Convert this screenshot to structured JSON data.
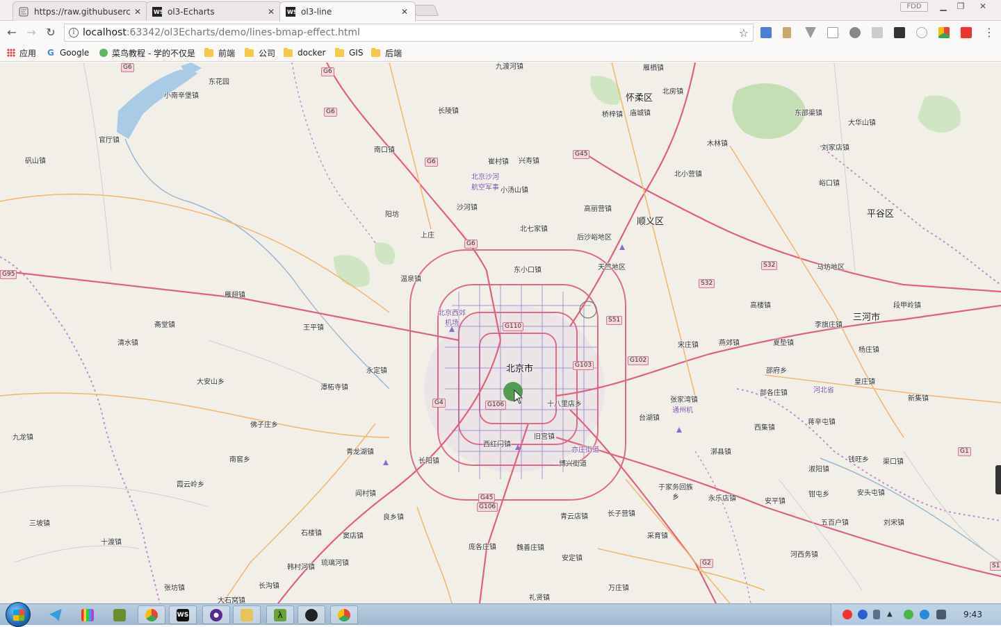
{
  "browser": {
    "tabs": [
      {
        "title": "https://raw.githubuserc",
        "active": false,
        "icon": "github-icon"
      },
      {
        "title": "ol3-Echarts",
        "active": false,
        "icon": "webstorm-icon"
      },
      {
        "title": "ol3-line",
        "active": true,
        "icon": "webstorm-icon"
      }
    ],
    "profile_label": "FDD",
    "url_host": "localhost",
    "url_path": ":63342/ol3Echarts/demo/lines-bmap-effect.html",
    "bookmarks": [
      {
        "label": "应用",
        "icon": "apps-grid-icon"
      },
      {
        "label": "Google",
        "icon": "google-icon"
      },
      {
        "label": "菜鸟教程 - 学的不仅是",
        "icon": "runoob-icon"
      },
      {
        "label": "前端",
        "icon": "folder-icon"
      },
      {
        "label": "公司",
        "icon": "folder-icon"
      },
      {
        "label": "docker",
        "icon": "folder-icon"
      },
      {
        "label": "GIS",
        "icon": "folder-icon"
      },
      {
        "label": "后端",
        "icon": "folder-icon"
      }
    ]
  },
  "map": {
    "places": [
      {
        "name": "小南辛堡镇"
      },
      {
        "name": "东花园"
      },
      {
        "name": "官厅镇"
      },
      {
        "name": "矾山镇"
      },
      {
        "name": "九渡河镇"
      },
      {
        "name": "怀柔区"
      },
      {
        "name": "北房镇"
      },
      {
        "name": "雁栖镇"
      },
      {
        "name": "长陵镇"
      },
      {
        "name": "桥梓镇"
      },
      {
        "name": "庙城镇"
      },
      {
        "name": "东邵渠镇"
      },
      {
        "name": "大华山镇"
      },
      {
        "name": "刘家店镇"
      },
      {
        "name": "南口镇"
      },
      {
        "name": "崔村镇"
      },
      {
        "name": "兴寿镇"
      },
      {
        "name": "木林镇"
      },
      {
        "name": "北京沙河"
      },
      {
        "name": "航空军事"
      },
      {
        "name": "小汤山镇"
      },
      {
        "name": "北小营镇"
      },
      {
        "name": "峪口镇"
      },
      {
        "name": "沙河镇"
      },
      {
        "name": "阳坊"
      },
      {
        "name": "高丽营镇"
      },
      {
        "name": "顺义区"
      },
      {
        "name": "平谷区"
      },
      {
        "name": "上庄"
      },
      {
        "name": "北七家镇"
      },
      {
        "name": "后沙峪地区"
      },
      {
        "name": "东小口镇"
      },
      {
        "name": "天竺地区"
      },
      {
        "name": "马坊地区"
      },
      {
        "name": "温泉镇"
      },
      {
        "name": "雁翅镇"
      },
      {
        "name": "高楼镇"
      },
      {
        "name": "段甲岭镇"
      },
      {
        "name": "北京西郊"
      },
      {
        "name": "机场"
      },
      {
        "name": "三河市"
      },
      {
        "name": "斋堂镇"
      },
      {
        "name": "王平镇"
      },
      {
        "name": "李旗庄镇"
      },
      {
        "name": "清水镇"
      },
      {
        "name": "宋庄镇"
      },
      {
        "name": "燕郊镇"
      },
      {
        "name": "夏垫镇"
      },
      {
        "name": "杨庄镇"
      },
      {
        "name": "永定镇"
      },
      {
        "name": "北京市"
      },
      {
        "name": "邵府乡"
      },
      {
        "name": "大安山乡"
      },
      {
        "name": "潭柘寺镇"
      },
      {
        "name": "部各庄镇"
      },
      {
        "name": "河北省"
      },
      {
        "name": "皇庄镇"
      },
      {
        "name": "十八里店乡"
      },
      {
        "name": "张家湾镇"
      },
      {
        "name": "通州机"
      },
      {
        "name": "新集镇"
      },
      {
        "name": "佛子庄乡"
      },
      {
        "name": "台湖镇"
      },
      {
        "name": "蒋辛屯镇"
      },
      {
        "name": "九龙镇"
      },
      {
        "name": "西集镇"
      },
      {
        "name": "西红门镇"
      },
      {
        "name": "旧宫镇"
      },
      {
        "name": "青龙湖镇"
      },
      {
        "name": "亦庄街道"
      },
      {
        "name": "漷县镇"
      },
      {
        "name": "南窖乡"
      },
      {
        "name": "长阳镇"
      },
      {
        "name": "博兴街道"
      },
      {
        "name": "钱旺乡"
      },
      {
        "name": "渠口镇"
      },
      {
        "name": "霞云岭乡"
      },
      {
        "name": "淑阳镇"
      },
      {
        "name": "于家务回族"
      },
      {
        "name": "乡"
      },
      {
        "name": "阎村镇"
      },
      {
        "name": "永乐店镇"
      },
      {
        "name": "钳屯乡"
      },
      {
        "name": "安头屯镇"
      },
      {
        "name": "安平镇"
      },
      {
        "name": "良乡镇"
      },
      {
        "name": "青云店镇"
      },
      {
        "name": "长子营镇"
      },
      {
        "name": "三坡镇"
      },
      {
        "name": "五百户镇"
      },
      {
        "name": "刘宋镇"
      },
      {
        "name": "石楼镇"
      },
      {
        "name": "窦店镇"
      },
      {
        "name": "采育镇"
      },
      {
        "name": "十渡镇"
      },
      {
        "name": "庞各庄镇"
      },
      {
        "name": "魏善庄镇"
      },
      {
        "name": "河西务镇"
      },
      {
        "name": "琉璃河镇"
      },
      {
        "name": "安定镇"
      },
      {
        "name": "韩村河镇"
      },
      {
        "name": "长沟镇"
      },
      {
        "name": "张坊镇"
      },
      {
        "name": "万庄镇"
      },
      {
        "name": "大石窝镇"
      },
      {
        "name": "礼贤镇"
      }
    ],
    "shields": [
      "G6",
      "G6",
      "G6",
      "G6",
      "G6",
      "G45",
      "G95",
      "S32",
      "S32",
      "S51",
      "G102",
      "G103",
      "G110",
      "G4",
      "G106",
      "G45",
      "G106",
      "G1",
      "G2",
      "S1"
    ],
    "effect_color": "#3a8f3a"
  },
  "taskbar": {
    "apps": [
      {
        "name": "telegram-icon"
      },
      {
        "name": "color-bars-icon"
      },
      {
        "name": "lambda-green-icon"
      },
      {
        "name": "chrome-icon"
      },
      {
        "name": "webstorm-icon"
      },
      {
        "name": "purple-app-icon"
      },
      {
        "name": "explorer-icon"
      },
      {
        "name": "lambda-icon"
      },
      {
        "name": "inkscape-icon"
      },
      {
        "name": "chrome-icon"
      }
    ],
    "clock": "9:43"
  }
}
